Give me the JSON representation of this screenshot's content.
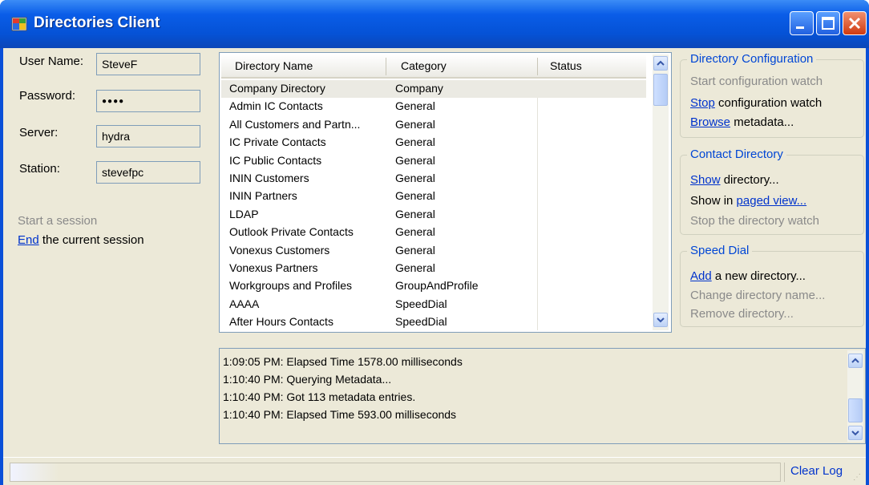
{
  "window": {
    "title": "Directories Client",
    "accent": "#0a50d8"
  },
  "session": {
    "username_label": "User Name:",
    "username_value": "SteveF",
    "password_label": "Password:",
    "password_value": "●●●●",
    "server_label": "Server:",
    "server_value": "hydra",
    "station_label": "Station:",
    "station_value": "stevefpc",
    "start_session": "Start a session",
    "end_link": "End",
    "end_rest": " the current session"
  },
  "grid": {
    "headers": [
      "Directory Name",
      "Category",
      "Status"
    ],
    "rows": [
      {
        "name": "Company Directory",
        "category": "Company"
      },
      {
        "name": "Admin IC Contacts",
        "category": "General"
      },
      {
        "name": "All Customers and Partn...",
        "category": "General"
      },
      {
        "name": "IC Private Contacts",
        "category": "General"
      },
      {
        "name": "IC Public Contacts",
        "category": "General"
      },
      {
        "name": "ININ Customers",
        "category": "General"
      },
      {
        "name": "ININ Partners",
        "category": "General"
      },
      {
        "name": "LDAP",
        "category": "General"
      },
      {
        "name": "Outlook Private Contacts",
        "category": "General"
      },
      {
        "name": "Vonexus Customers",
        "category": "General"
      },
      {
        "name": "Vonexus Partners",
        "category": "General"
      },
      {
        "name": "Workgroups and Profiles",
        "category": "GroupAndProfile"
      },
      {
        "name": "AAAA",
        "category": "SpeedDial"
      },
      {
        "name": "After Hours Contacts",
        "category": "SpeedDial"
      }
    ]
  },
  "directory_config": {
    "title": "Directory Configuration",
    "start_watch": "Start configuration watch",
    "stop_link": "Stop",
    "stop_rest": " configuration watch",
    "browse_link": "Browse",
    "browse_rest": " metadata..."
  },
  "contact_directory": {
    "title": "Contact Directory",
    "show_link": "Show",
    "show_rest": " directory...",
    "show_in_prefix": "Show in ",
    "paged_view_link": "paged view...",
    "stop_watch": "Stop the directory watch"
  },
  "speed_dial": {
    "title": "Speed Dial",
    "add_link": "Add",
    "add_rest": " a new directory...",
    "change_name": "Change directory name...",
    "remove": "Remove directory..."
  },
  "log": {
    "lines": [
      "1:09:05 PM: Elapsed Time 1578.00 milliseconds",
      "1:10:40 PM: Querying Metadata...",
      "1:10:40 PM: Got 113 metadata entries.",
      "1:10:40 PM: Elapsed Time 593.00 milliseconds"
    ]
  },
  "statusbar": {
    "clear_log": "Clear Log"
  }
}
